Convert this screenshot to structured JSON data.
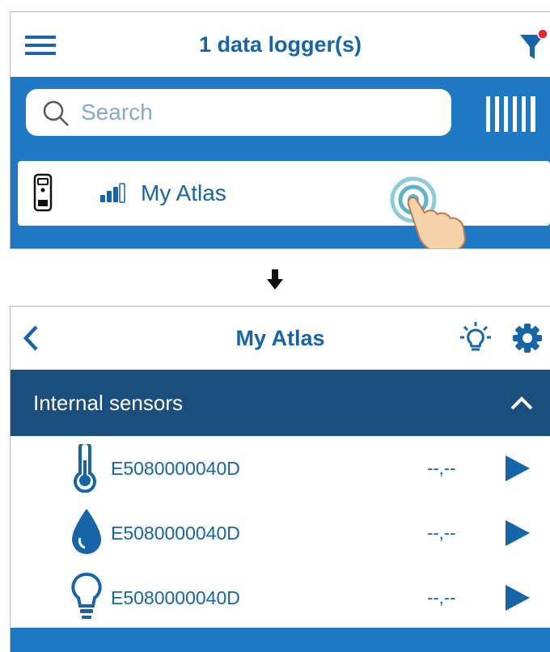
{
  "logger_list": {
    "title": "1 data logger(s)",
    "search_placeholder": "Search",
    "logger": {
      "name": "My Atlas"
    }
  },
  "detail": {
    "title": "My Atlas",
    "section": {
      "label": "Internal sensors"
    },
    "sensors": [
      {
        "icon": "thermometer-icon",
        "id": "E5080000040D",
        "value": "--,--"
      },
      {
        "icon": "droplet-icon",
        "id": "E5080000040D",
        "value": "--,--"
      },
      {
        "icon": "lightbulb-icon",
        "id": "E5080000040D",
        "value": "--,--"
      }
    ]
  },
  "colors": {
    "brand_blue": "#1e78c3",
    "dark_blue": "#1a4e7c",
    "text_blue": "#1565a8",
    "filter_badge": "#e0282e"
  }
}
